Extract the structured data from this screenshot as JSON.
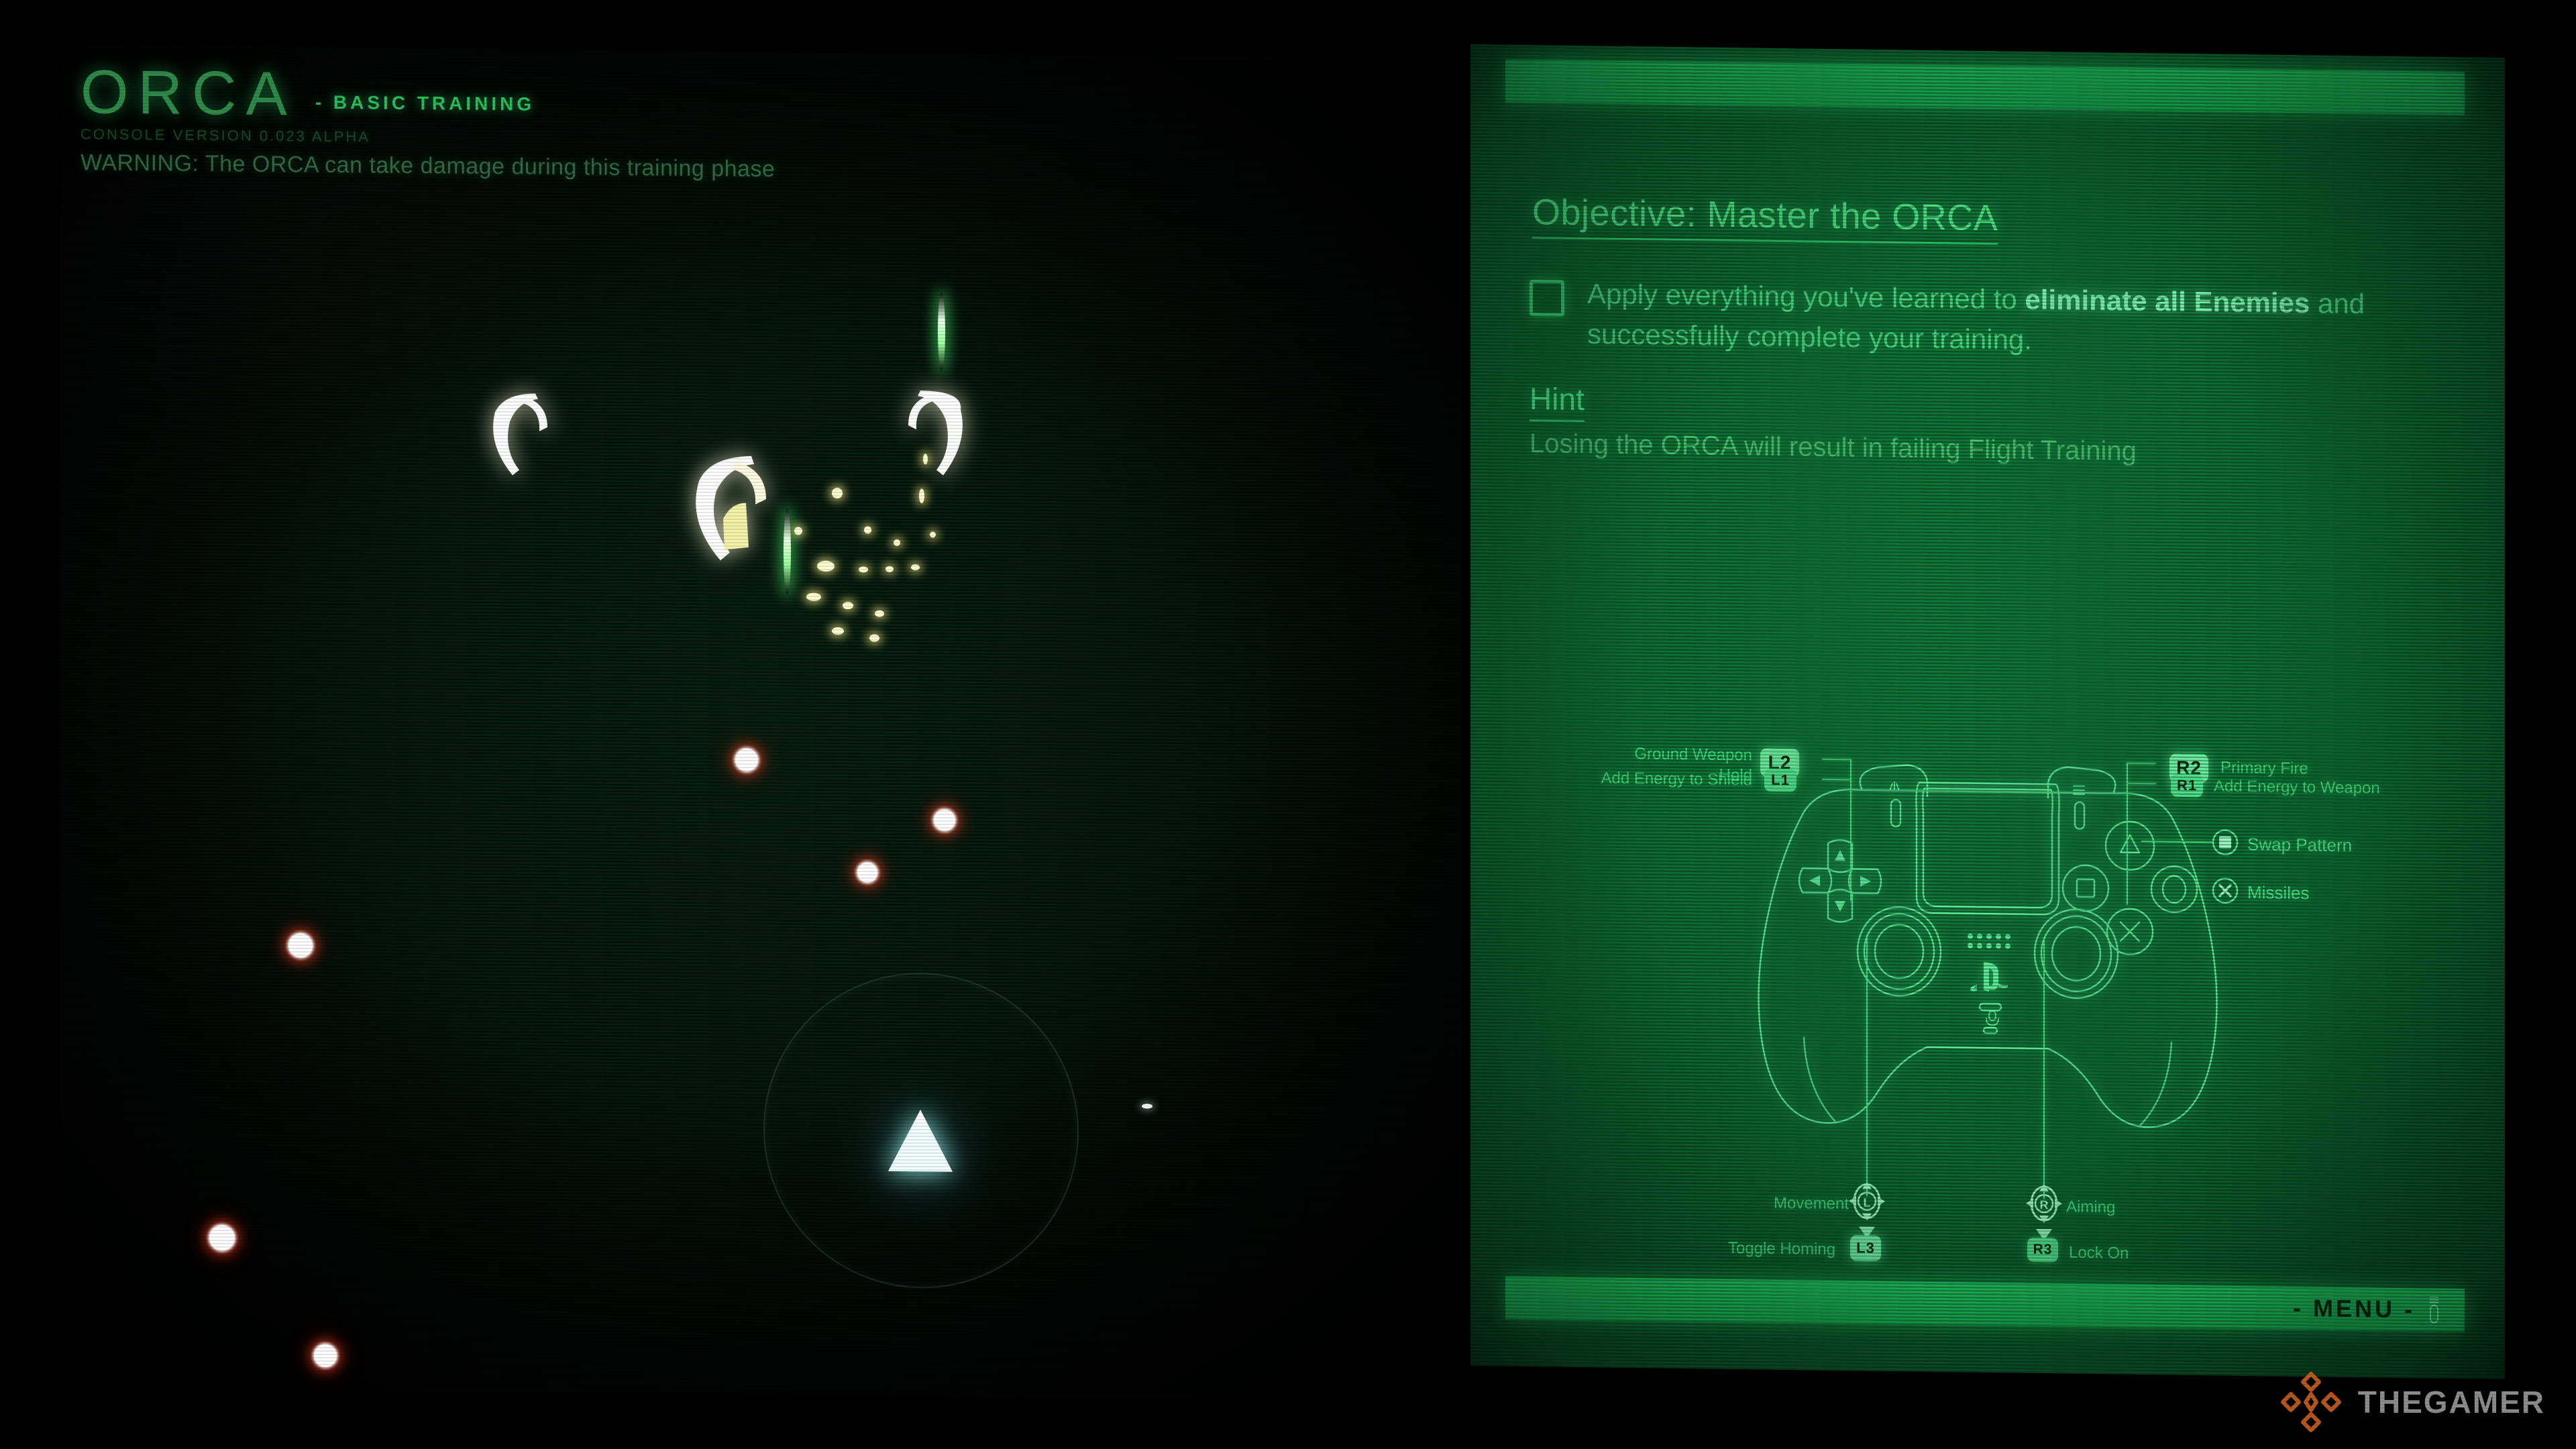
{
  "game": {
    "title": "ORCA",
    "subtitle": "- BASIC TRAINING",
    "version": "CONSOLE VERSION 0.023 ALPHA",
    "warning": "WARNING: The ORCA can take damage during this training phase"
  },
  "briefing": {
    "objective_title": "Objective: Master the ORCA",
    "objective_text_part1": "Apply everything you've learned to ",
    "objective_text_bold1": "eliminate all Enemies",
    "objective_text_part2": " and successfully complete your training.",
    "hint_title": "Hint",
    "hint_text": "Losing the ORCA will result in failing Flight Training",
    "menu_label": "- MENU -"
  },
  "controls": {
    "shoulder_left": [
      {
        "label": "Ground Weapon\nHold",
        "badge": "L2",
        "emphasis": "strong"
      },
      {
        "label": "Add Energy to Shield",
        "badge": "L1",
        "emphasis": "dim"
      }
    ],
    "shoulder_right": [
      {
        "badge": "R2",
        "label": "Primary Fire",
        "emphasis": "strong"
      },
      {
        "badge": "R1",
        "label": "Add Energy to Weapon",
        "emphasis": "dim"
      }
    ],
    "face_buttons": [
      {
        "icon": "square-button-icon",
        "label": "Swap Pattern"
      },
      {
        "icon": "cross-button-icon",
        "label": "Missiles"
      }
    ],
    "sticks": [
      {
        "stick": "L",
        "label": "Movement",
        "press_badge": "L3",
        "press_label": "Toggle Homing"
      },
      {
        "stick": "R",
        "label": "Aiming",
        "press_badge": "R3",
        "press_label": "Lock On"
      }
    ]
  },
  "hud": {
    "ground_weapon_line1": "Ground Weapon",
    "ground_weapon_line2": "Hold",
    "add_energy_shield": "Add Energy to Shield",
    "primary_fire": "Primary Fire",
    "add_energy_weapon": "Add Energy to Weapon",
    "swap_pattern": "Swap Pattern",
    "missiles": "Missiles",
    "movement": "Movement",
    "toggle_homing": "Toggle Homing",
    "aiming": "Aiming",
    "lock_on": "Lock On",
    "badge_l2": "L2",
    "badge_l1": "L1",
    "badge_r2": "R2",
    "badge_r1": "R1",
    "badge_l3": "L3",
    "badge_r3": "R3"
  },
  "watermark": {
    "text": "THEGAMER",
    "logo_color": "#c9601f"
  },
  "colors": {
    "panel_green": "#0d6831",
    "accent_green": "#2bbd5d",
    "bar_green": "#1fc45f",
    "hud_green": "#2f8a4a",
    "enemy_white": "#ffffff",
    "player_cyan": "#b9fdff"
  }
}
